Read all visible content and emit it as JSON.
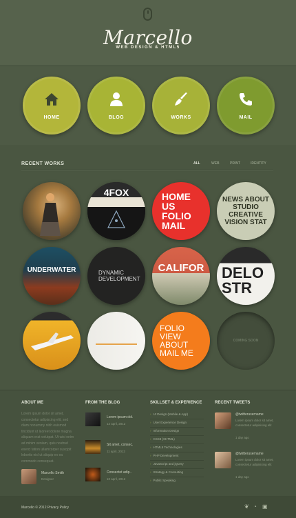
{
  "header": {
    "logo": "Marcello",
    "tagline": "WEB DESIGN & HTML5"
  },
  "nav": [
    {
      "label": "HOME",
      "icon": "house-icon",
      "color": "#b3b63a"
    },
    {
      "label": "BLOG",
      "icon": "user-icon",
      "color": "#a8b435"
    },
    {
      "label": "WORKS",
      "icon": "brush-icon",
      "color": "#a7b238"
    },
    {
      "label": "MAIL",
      "icon": "phone-icon",
      "color": "#7f9b2f"
    }
  ],
  "works": {
    "title": "RECENT WORKS",
    "filters": [
      "ALL",
      "WEB",
      "PRINT",
      "IDENTITY"
    ],
    "items": [
      {
        "name": "work-woman-portrait",
        "text": ""
      },
      {
        "name": "work-4fox",
        "text": "4FOX"
      },
      {
        "name": "work-home-us-folio-mail",
        "text": "HOME US FOLIO MAIL"
      },
      {
        "name": "work-news-about-studio",
        "text": "NEWS ABOUT STUDIO CREATIVE VISION STAT"
      },
      {
        "name": "work-underwater",
        "text": "UNDERWATER"
      },
      {
        "name": "work-dynamic-development",
        "text": "DYNAMIC DEVELOPMENT"
      },
      {
        "name": "work-califor",
        "text": "CALIFOR"
      },
      {
        "name": "work-delo-str",
        "text": "DELO STR"
      },
      {
        "name": "work-airplane",
        "text": ""
      },
      {
        "name": "work-minimal-site",
        "text": ""
      },
      {
        "name": "work-folio-view-about-mail",
        "text": "FOLIO VIEW ABOUT MAIL ME"
      },
      {
        "name": "work-coming-soon",
        "text": "COMING SOON"
      }
    ]
  },
  "footer": {
    "about": {
      "title": "ABOUT ME",
      "text": "Lorem ipsum dolor sit amet, consectetur adipiscing elit, sed diam nonummy nibh euismod tincidunt ut laoreet dolore magna aliquam erat volutpat. Ut wisi enim ad minim veniam, quis nostrud exerci tation ullamcorper suscipit lobortis nisl ut aliquip ex ea commodo consequat.",
      "name": "Marcello Smith",
      "role": "Designer"
    },
    "blog": {
      "title": "FROM THE BLOG",
      "posts": [
        {
          "title": "Lorem ipsum dol.",
          "date": "12 april, 2012"
        },
        {
          "title": "Sit amet, consec.",
          "date": "11 april, 2012"
        },
        {
          "title": "Consectet adip..",
          "date": "10 april, 2012"
        }
      ]
    },
    "skills": {
      "title": "SKILLSET & EXPERIENCE",
      "items": [
        "UI Design (Mobile & App)",
        "User Experience Design",
        "Information Design",
        "CSS3 (XHTML)",
        "HTML5 Technologies",
        "PHP Development",
        "JavaScript and jQuery",
        "Strategy & Consulting",
        "Public Speaking"
      ]
    },
    "tweets": {
      "title": "RECENT TWEETS",
      "items": [
        {
          "handle": "@twitterusername",
          "text": "Lorem ipsum dolor sit amet, consectetur adipisicing elit",
          "time": "1 day ago"
        },
        {
          "handle": "@twitterusername",
          "text": "Lorem ipsum dolor sit amet, consectetur adipisicing elit",
          "time": "1 day ago"
        }
      ]
    }
  },
  "bottom": {
    "copyright": "Marcello © 2012 Privacy Policy",
    "social": [
      "twitter-icon",
      "rss-icon",
      "facebook-icon"
    ]
  }
}
